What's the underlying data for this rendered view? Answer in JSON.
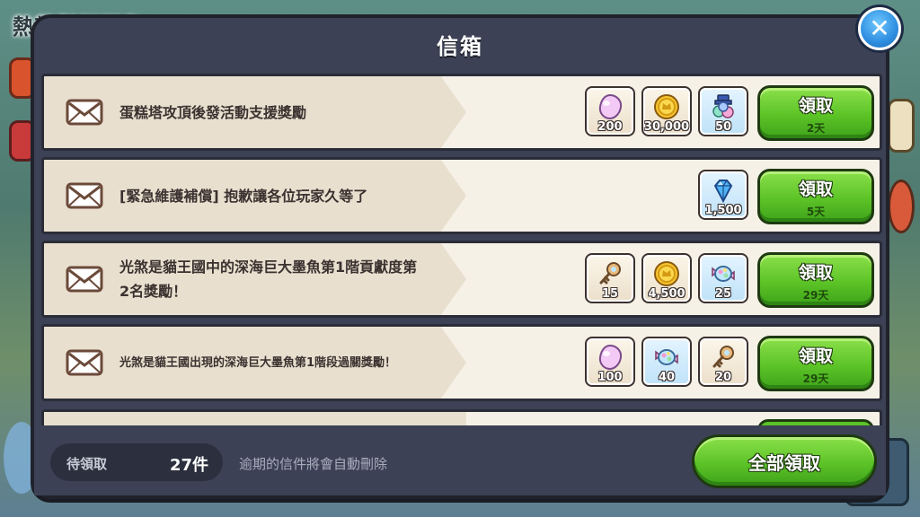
{
  "background": {
    "title": "熱帶鬆餅群島"
  },
  "mailbox": {
    "title": "信箱",
    "close_icon": "close-icon",
    "mails": [
      {
        "text": "蛋糕塔攻頂後發活動支援獎勵",
        "rewards": [
          {
            "icon": "crystal-jelly-icon",
            "qty": "200"
          },
          {
            "icon": "coin-icon",
            "qty": "30,000"
          },
          {
            "icon": "gift-box-icon",
            "qty": "50"
          }
        ],
        "claim_label": "領取",
        "days_left": "2天"
      },
      {
        "text": "[緊急維護補償] 抱歉讓各位玩家久等了",
        "rewards": [
          {
            "icon": "diamond-icon",
            "qty": "1,500"
          }
        ],
        "claim_label": "領取",
        "days_left": "5天"
      },
      {
        "text": "光煞是貓王國中的深海巨大墨魚第1階貢獻度第2名獎勵！",
        "rewards": [
          {
            "icon": "key-icon",
            "qty": "15"
          },
          {
            "icon": "coin-icon",
            "qty": "4,500"
          },
          {
            "icon": "candy-icon",
            "qty": "25"
          }
        ],
        "claim_label": "領取",
        "days_left": "29天"
      },
      {
        "text": "光煞是貓王國出現的深海巨大墨魚第1階段過關獎勵！",
        "rewards": [
          {
            "icon": "crystal-jelly-icon",
            "qty": "100"
          },
          {
            "icon": "candy-icon",
            "qty": "40"
          },
          {
            "icon": "key-icon",
            "qty": "20"
          }
        ],
        "claim_label": "領取",
        "days_left": "29天"
      }
    ],
    "footer": {
      "pending_label": "待領取",
      "pending_count": "27件",
      "expire_note": "逾期的信件將會自動刪除",
      "claim_all_label": "全部領取"
    }
  }
}
